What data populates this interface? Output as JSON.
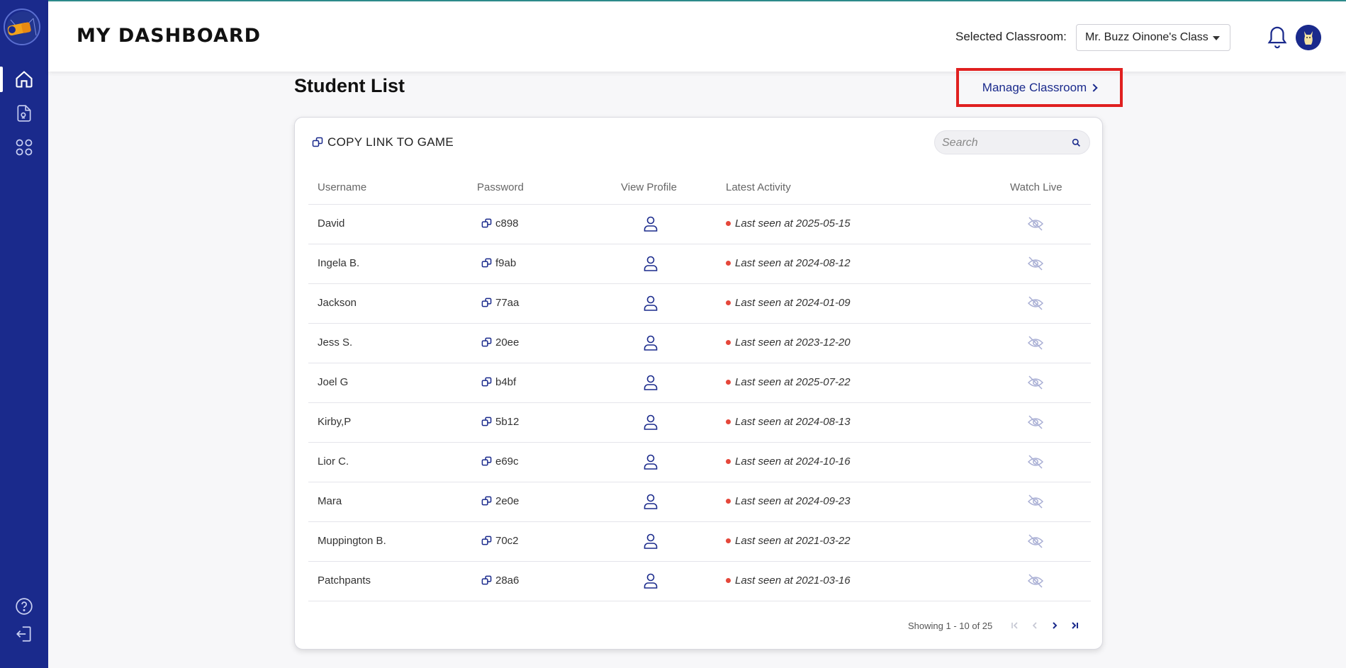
{
  "header": {
    "title": "my DASHBOARD",
    "classroom_label": "Selected Classroom:",
    "classroom_selected": "Mr. Buzz Oinone's Class"
  },
  "sidebar": {
    "items": [
      {
        "icon": "home-icon",
        "active": true
      },
      {
        "icon": "document-icon",
        "active": false
      },
      {
        "icon": "apps-grid-icon",
        "active": false
      }
    ],
    "bottom": [
      {
        "icon": "help-icon"
      },
      {
        "icon": "logout-icon"
      }
    ]
  },
  "main": {
    "section_title": "Student List",
    "manage_label": "Manage Classroom",
    "copy_link_label": "COPY LINK TO GAME",
    "search_placeholder": "Search",
    "columns": [
      "Username",
      "Password",
      "View Profile",
      "Latest Activity",
      "Watch Live"
    ],
    "rows": [
      {
        "username": "David",
        "password": "c898",
        "activity": "Last seen at 2025-05-15"
      },
      {
        "username": "Ingela B.",
        "password": "f9ab",
        "activity": "Last seen at 2024-08-12"
      },
      {
        "username": "Jackson",
        "password": "77aa",
        "activity": "Last seen at 2024-01-09"
      },
      {
        "username": "Jess S.",
        "password": "20ee",
        "activity": "Last seen at 2023-12-20"
      },
      {
        "username": "Joel G",
        "password": "b4bf",
        "activity": "Last seen at 2025-07-22"
      },
      {
        "username": "Kirby,P",
        "password": "5b12",
        "activity": "Last seen at 2024-08-13"
      },
      {
        "username": "Lior C.",
        "password": "e69c",
        "activity": "Last seen at 2024-10-16"
      },
      {
        "username": "Mara",
        "password": "2e0e",
        "activity": "Last seen at 2024-09-23"
      },
      {
        "username": "Muppington B.",
        "password": "70c2",
        "activity": "Last seen at 2021-03-22"
      },
      {
        "username": "Patchpants",
        "password": "28a6",
        "activity": "Last seen at 2021-03-16"
      }
    ],
    "pagination": {
      "text": "Showing 1 - 10 of 25"
    }
  },
  "colors": {
    "sidebar": "#1a2a8c",
    "accent": "#1a2a8c",
    "status_dot": "#e5473a",
    "highlight_box": "#e02020"
  }
}
